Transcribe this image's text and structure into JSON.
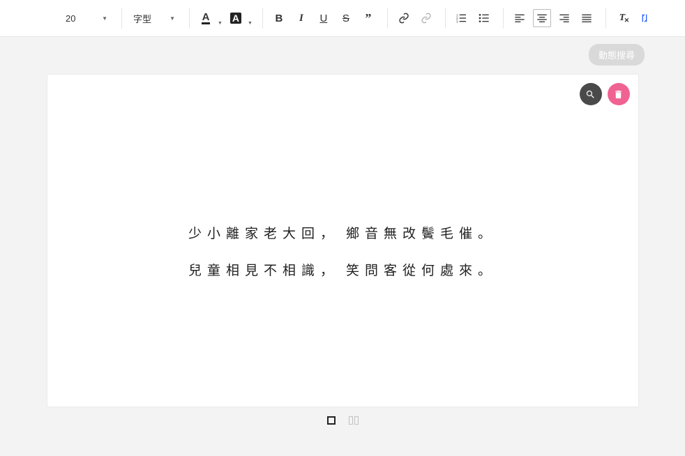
{
  "toolbar": {
    "font_size": "20",
    "font_family": "字型",
    "text_color_glyph": "A",
    "bg_color_glyph": "A",
    "bold": "B",
    "italic": "I",
    "underline": "U",
    "strike": "S",
    "quote": "”"
  },
  "dynamic_search_label": "動態搜尋",
  "poem": {
    "line1_left": "少小離家老大回，",
    "line1_right": "鄉音無改鬢毛催。",
    "line2_left": "兒童相見不相識，",
    "line2_right": "笑問客從何處來。"
  },
  "colors": {
    "toolbar_border": "#e5e5e5",
    "bg": "#f3f3f3",
    "dark_circle": "#4a4a4a",
    "pink_circle": "#f06292",
    "pill": "#d9d9d9"
  }
}
